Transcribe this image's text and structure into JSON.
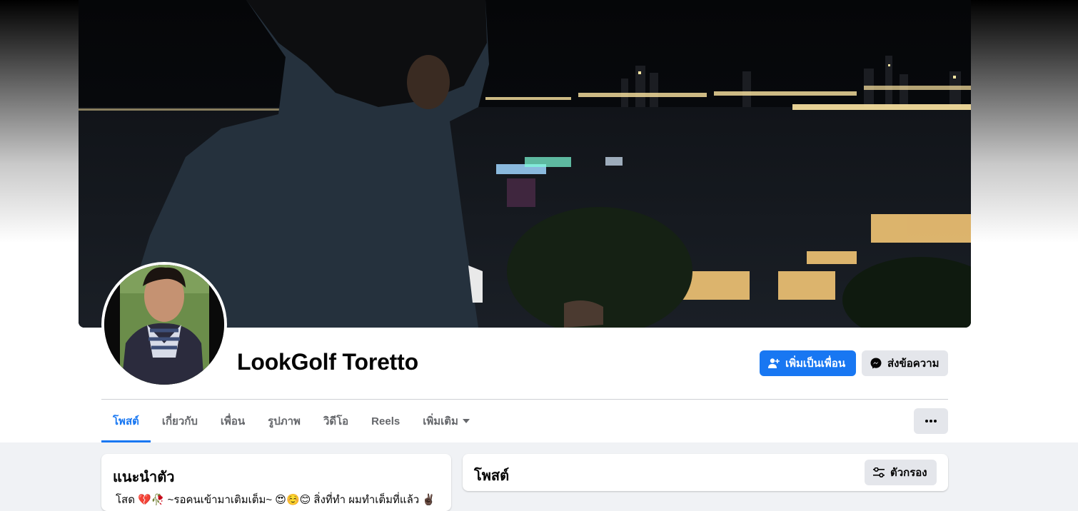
{
  "profile": {
    "name": "LookGolf Toretto",
    "add_friend_label": "เพิ่มเป็นเพื่อน",
    "message_label": "ส่งข้อความ"
  },
  "tabs": [
    {
      "label": "โพสต์",
      "active": true
    },
    {
      "label": "เกี่ยวกับ",
      "active": false
    },
    {
      "label": "เพื่อน",
      "active": false
    },
    {
      "label": "รูปภาพ",
      "active": false
    },
    {
      "label": "วิดีโอ",
      "active": false
    },
    {
      "label": "Reels",
      "active": false
    },
    {
      "label": "เพิ่มเติม",
      "active": false
    }
  ],
  "intro": {
    "title": "แนะนำตัว",
    "bio": "โสด 💔🥀 ~รอคนเข้ามาเติมเต็ม~ 😍☺️😊 สิ่งที่ทำ ผมทำเต็มที่แล้ว ✌🏿"
  },
  "posts": {
    "title": "โพสต์",
    "filter_label": "ตัวกรอง"
  },
  "colors": {
    "primary": "#1877f2",
    "secondary_button": "#e4e6eb",
    "page_bg": "#f0f2f5",
    "text": "#050505",
    "muted_text": "#65676b"
  },
  "icons": {
    "add_friend": "person-plus-icon",
    "message": "messenger-icon",
    "more": "ellipsis-icon",
    "dropdown": "caret-down-icon",
    "filter": "sliders-icon"
  }
}
